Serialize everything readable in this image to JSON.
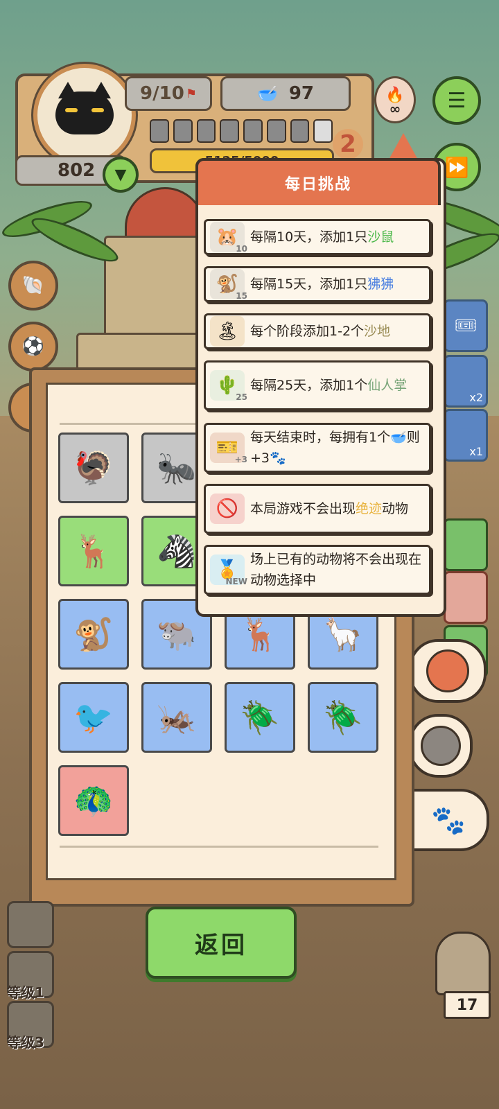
{
  "hud": {
    "round_progress": "9/10",
    "food_count": "97",
    "score": "802",
    "exp_value": "5125/5000",
    "level_badge": "2",
    "infinity_symbol": "∞"
  },
  "popup": {
    "title": "每日挑战",
    "rules": [
      {
        "icon": "gerbil-icon",
        "badge": "10",
        "parts": [
          "每隔10天，添加1只",
          "沙鼠",
          ""
        ]
      },
      {
        "icon": "baboon-icon",
        "badge": "15",
        "parts": [
          "每隔15天，添加1只",
          "狒狒",
          ""
        ]
      },
      {
        "icon": "sand-shovel-icon",
        "badge": "",
        "parts": [
          "每个阶段添加1-2个",
          "沙地",
          ""
        ]
      },
      {
        "icon": "cactus-icon",
        "badge": "25",
        "parts": [
          "每隔25天，添加1个",
          "仙人掌",
          ""
        ]
      },
      {
        "icon": "food-ticket-icon",
        "badge": "+3",
        "parts": [
          "每天结束时，每拥有1个",
          "",
          "则+3"
        ]
      },
      {
        "icon": "no-extinct-icon",
        "badge": "",
        "parts": [
          "本局游戏不会出现",
          "绝迹",
          "动物"
        ]
      },
      {
        "icon": "new-badge-icon",
        "badge": "NEW",
        "parts": [
          "场上已有的动物将不会出现在动物选择中",
          "",
          ""
        ]
      }
    ]
  },
  "board": {
    "tiles": [
      {
        "name": "turkey-tile",
        "glyph": "🦃",
        "color": "gray"
      },
      {
        "name": "ant-tile",
        "glyph": "🐜",
        "color": "gray"
      },
      {
        "name": "gazelle-tile",
        "glyph": "🦌",
        "color": "green"
      },
      {
        "name": "zebra-tile",
        "glyph": "🦓",
        "color": "green"
      },
      {
        "name": "baboon-tile",
        "glyph": "🐒",
        "color": "blue"
      },
      {
        "name": "musk-ox-tile",
        "glyph": "🐃",
        "color": "blue"
      },
      {
        "name": "elk-tile",
        "glyph": "🦌",
        "color": "blue"
      },
      {
        "name": "alpaca-tile",
        "glyph": "🦙",
        "color": "blue"
      },
      {
        "name": "magpie-tile",
        "glyph": "🐦",
        "color": "blue"
      },
      {
        "name": "mantis-tile",
        "glyph": "🦗",
        "color": "blue"
      },
      {
        "name": "firefly-tile-1",
        "glyph": "🪲",
        "color": "blue"
      },
      {
        "name": "firefly-tile-2",
        "glyph": "🪲",
        "color": "blue"
      },
      {
        "name": "peacock-tile",
        "glyph": "🦚",
        "color": "pink"
      }
    ]
  },
  "side": {
    "slot_counts": [
      "x2",
      "x1"
    ],
    "level_labels": [
      "等级1",
      "等级3"
    ],
    "owl_count": "17"
  },
  "buttons": {
    "return_label": "返回"
  },
  "colors": {
    "popup_header": "#e4754f",
    "tile_green": "#99dd7a",
    "tile_blue": "#98bdf2",
    "tile_pink": "#f2a19a",
    "tile_gray": "#c6c6c6",
    "return_button": "#8ed96a"
  }
}
